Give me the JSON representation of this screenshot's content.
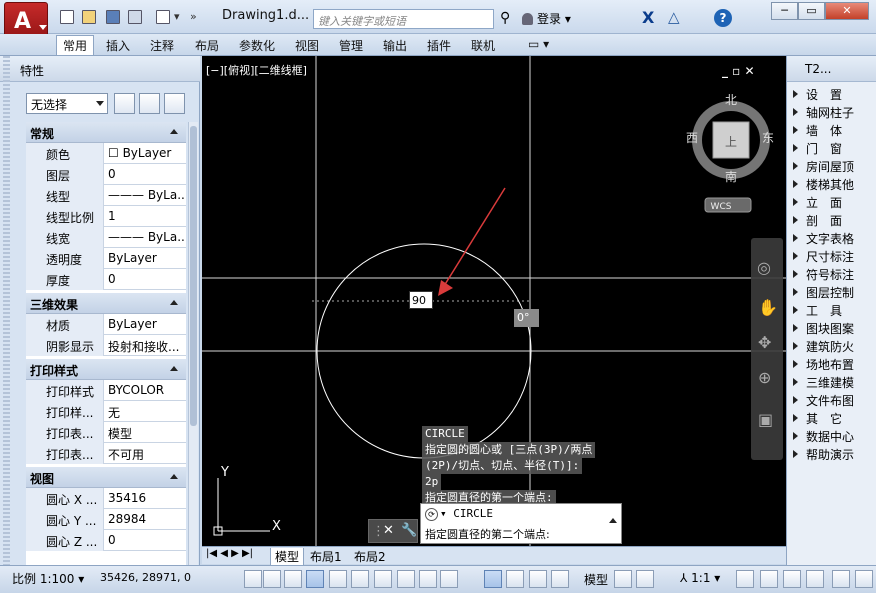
{
  "app": {
    "title": "Drawing1.d...",
    "search_placeholder": "键入关键字或短语",
    "login": "登录",
    "help": "?"
  },
  "window_buttons": {
    "minimize": "─",
    "restore": "▭",
    "close": "✕"
  },
  "ribbon": {
    "tabs": [
      "常用",
      "插入",
      "注释",
      "布局",
      "参数化",
      "视图",
      "管理",
      "输出",
      "插件",
      "联机"
    ]
  },
  "properties": {
    "title": "特性",
    "selection": "无选择",
    "sections": [
      {
        "name": "常规",
        "rows": [
          {
            "k": "颜色",
            "v": "☐ ByLayer"
          },
          {
            "k": "图层",
            "v": "0"
          },
          {
            "k": "线型",
            "v": "——— ByLa..."
          },
          {
            "k": "线型比例",
            "v": "1"
          },
          {
            "k": "线宽",
            "v": "——— ByLa..."
          },
          {
            "k": "透明度",
            "v": "ByLayer"
          },
          {
            "k": "厚度",
            "v": "0"
          }
        ]
      },
      {
        "name": "三维效果",
        "rows": [
          {
            "k": "材质",
            "v": "ByLayer"
          },
          {
            "k": "阴影显示",
            "v": "投射和接收..."
          }
        ]
      },
      {
        "name": "打印样式",
        "rows": [
          {
            "k": "打印样式",
            "v": "BYCOLOR"
          },
          {
            "k": "打印样...",
            "v": "无"
          },
          {
            "k": "打印表...",
            "v": "模型"
          },
          {
            "k": "打印表...",
            "v": "不可用"
          }
        ]
      },
      {
        "name": "视图",
        "rows": [
          {
            "k": "圆心 X ...",
            "v": "35416"
          },
          {
            "k": "圆心 Y ...",
            "v": "28984"
          },
          {
            "k": "圆心 Z ...",
            "v": "0"
          }
        ]
      }
    ]
  },
  "viewport": {
    "label": "[−][俯视][二维线框]",
    "controls": "_ ▫ ✕",
    "viewcube": {
      "north": "北",
      "south": "南",
      "east": "东",
      "west": "西",
      "face": "上",
      "wcs": "WCS"
    },
    "dynamic_input": "90",
    "angle": "0°",
    "ucs": {
      "y": "Y",
      "x": "X"
    }
  },
  "command": {
    "history": [
      "CIRCLE",
      "指定圆的圆心或 [三点(3P)/两点",
      "(2P)/切点、切点、半径(T)]:",
      "2p",
      "指定圆直径的第一个端点:"
    ],
    "current_cmd": "CIRCLE",
    "prompt": "指定圆直径的第二个端点:"
  },
  "tool_palette": {
    "title": "T2...",
    "items": [
      "设　置",
      "轴网柱子",
      "墙　体",
      "门　窗",
      "房间屋顶",
      "楼梯其他",
      "立　面",
      "剖　面",
      "文字表格",
      "尺寸标注",
      "符号标注",
      "图层控制",
      "工　具",
      "图块图案",
      "建筑防火",
      "场地布置",
      "三维建模",
      "文件布图",
      "其　它",
      "数据中心",
      "帮助演示"
    ]
  },
  "layout_tabs": [
    "模型",
    "布局1",
    "布局2"
  ],
  "status": {
    "scale": "比例 1:100",
    "coords": "35426, 28971, 0",
    "model": "模型",
    "anno_scale": "1:1"
  }
}
